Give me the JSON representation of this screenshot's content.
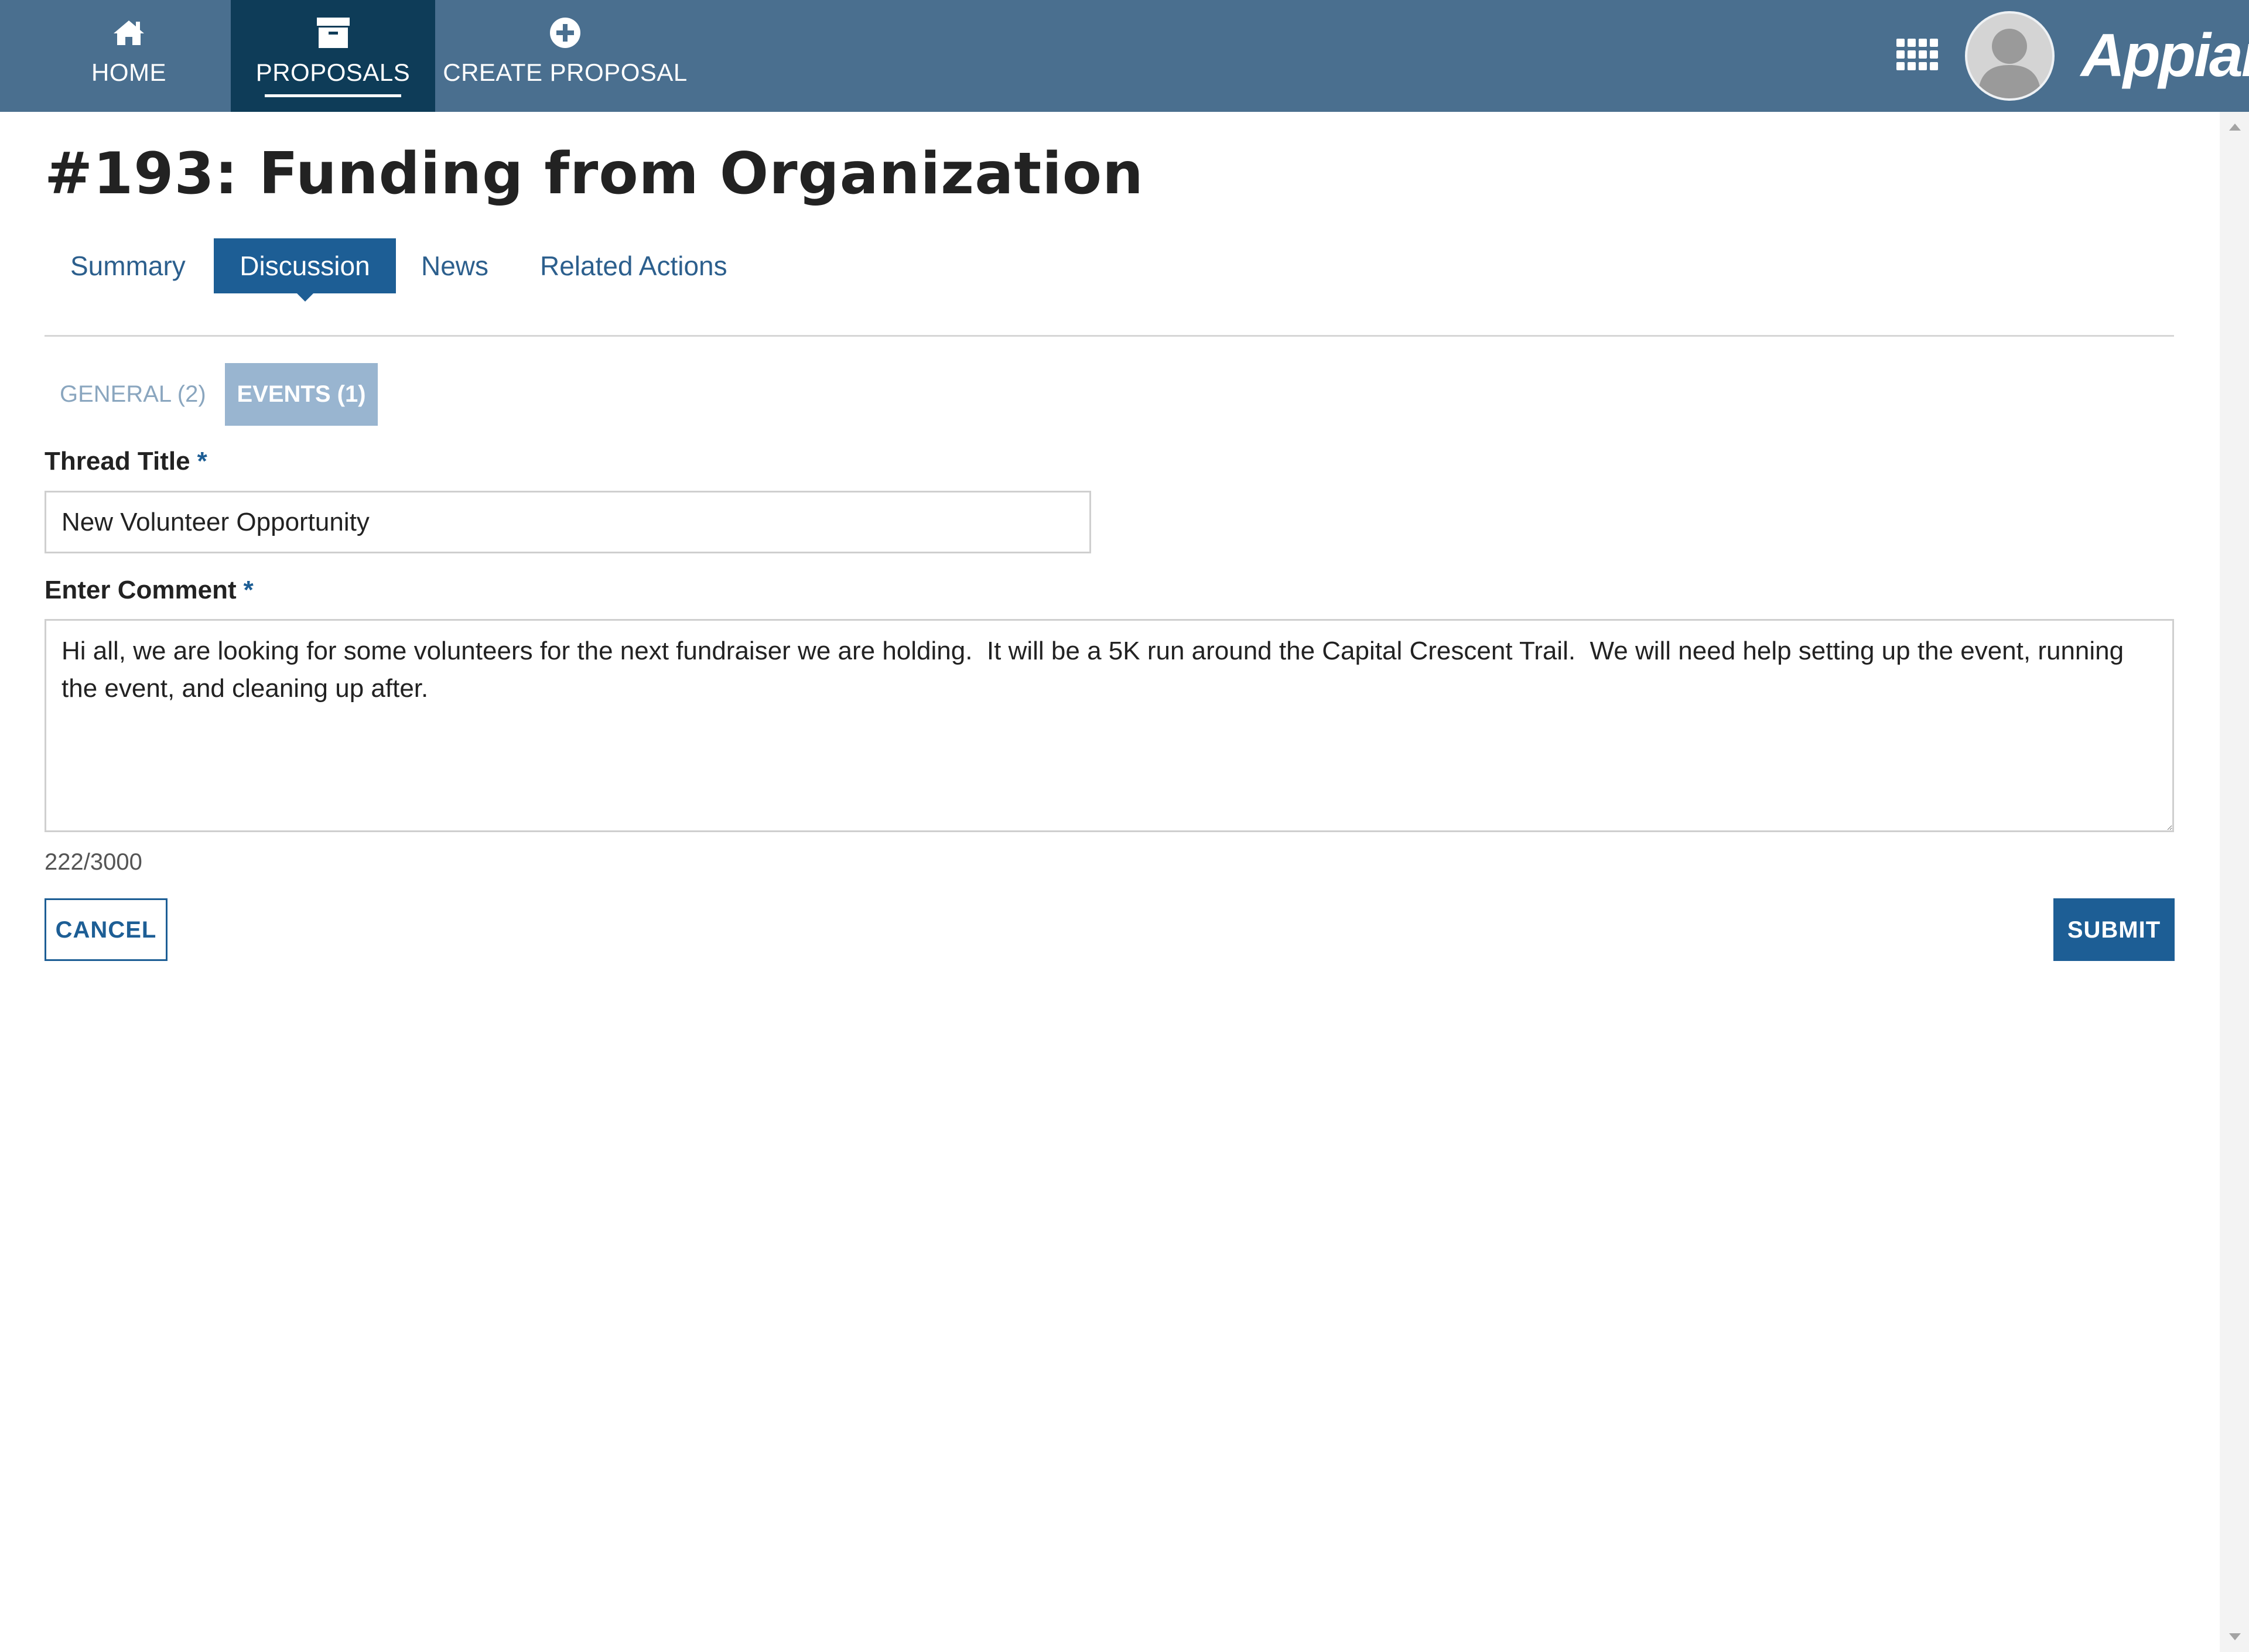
{
  "nav": {
    "items": [
      {
        "label": "HOME",
        "icon": "home-icon"
      },
      {
        "label": "PROPOSALS",
        "icon": "archive-box-icon",
        "active": true
      },
      {
        "label": "CREATE PROPOSAL",
        "icon": "plus-circle-icon"
      }
    ],
    "logo": "Appian",
    "apps_icon": "grid-icon",
    "avatar_icon": "user-avatar-icon"
  },
  "record": {
    "title": "#193: Funding from Organization",
    "tabs": [
      {
        "label": "Summary"
      },
      {
        "label": "Discussion",
        "active": true
      },
      {
        "label": "News"
      },
      {
        "label": "Related Actions"
      }
    ]
  },
  "discussion": {
    "sub_tabs": [
      {
        "label": "GENERAL (2)"
      },
      {
        "label": "EVENTS (1)",
        "active": true
      }
    ],
    "form": {
      "thread_title_label": "Thread Title",
      "thread_title_value": "New Volunteer Opportunity",
      "comment_label": "Enter Comment",
      "comment_value": "Hi all, we are looking for some volunteers for the next fundraiser we are holding.  It will be a 5K run around the Capital Crescent Trail.  We will need help setting up the event, running the event, and cleaning up after.",
      "required_marker": "*",
      "char_count": "222/3000",
      "cancel_label": "CANCEL",
      "submit_label": "SUBMIT"
    }
  },
  "colors": {
    "topbar": "#4a6f8f",
    "active_nav": "#0e3c58",
    "accent": "#1d5e95",
    "sub_tab_active": "#99b5d0"
  }
}
